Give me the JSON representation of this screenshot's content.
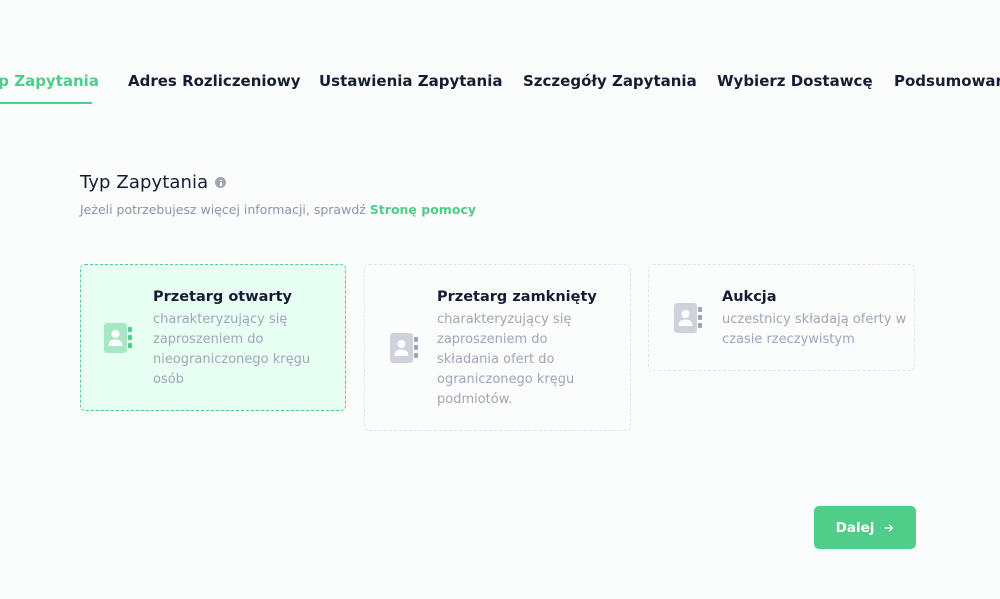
{
  "tabs": [
    {
      "label": "Typ Zapytania",
      "active": true
    },
    {
      "label": "Adres Rozliczeniowy",
      "active": false
    },
    {
      "label": "Ustawienia Zapytania",
      "active": false
    },
    {
      "label": "Szczegóły Zapytania",
      "active": false
    },
    {
      "label": "Wybierz Dostawcę",
      "active": false
    },
    {
      "label": "Podsumowanie",
      "active": false
    }
  ],
  "section": {
    "title": "Typ Zapytania",
    "subtitle_text": "Jeżeli potrzebujesz więcej informacji, sprawdź ",
    "help_link": "Stronę pomocy"
  },
  "options": [
    {
      "title": "Przetarg otwarty",
      "description": "charakteryzujący się zaproszeniem do nieograniczonego kręgu osób",
      "selected": true,
      "icon": "contact-book-icon"
    },
    {
      "title": "Przetarg zamknięty",
      "description": "charakteryzujący się zaproszeniem do składania ofert do ograniczonego kręgu podmiotów.",
      "selected": false,
      "icon": "contact-book-icon"
    },
    {
      "title": "Aukcja",
      "description": "uczestnicy składają oferty w czasie rzeczywistym",
      "selected": false,
      "icon": "contact-book-icon"
    }
  ],
  "actions": {
    "next_label": "Dalej"
  },
  "colors": {
    "accent": "#50cd89",
    "accent_light": "#e8fff3",
    "muted_text": "#a1a5b7",
    "heading_text": "#181c32"
  }
}
